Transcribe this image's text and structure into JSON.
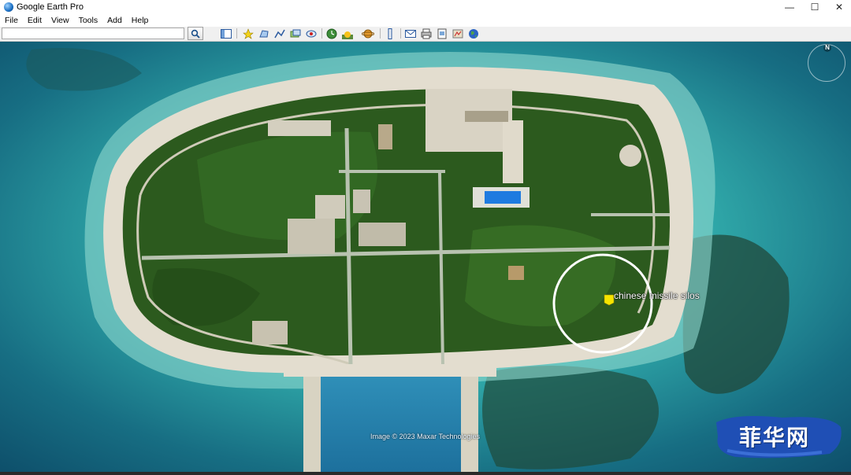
{
  "window": {
    "title": "Google Earth Pro",
    "controls": {
      "minimize": "—",
      "maximize": "☐",
      "close": "✕"
    }
  },
  "menu": {
    "items": [
      "File",
      "Edit",
      "View",
      "Tools",
      "Add",
      "Help"
    ]
  },
  "search": {
    "value": "",
    "placeholder": ""
  },
  "toolbar": {
    "buttons": [
      "sidebar-icon",
      "placemark-icon",
      "polygon-icon",
      "path-icon",
      "image-overlay-icon",
      "record-tour-icon",
      "historical-imagery-icon",
      "sunlight-icon",
      "planets-icon",
      "ruler-icon",
      "email-icon",
      "print-icon",
      "save-image-icon",
      "view-in-maps-icon",
      "earth-icon"
    ]
  },
  "map": {
    "placemark_label": "chinese missile silos",
    "attribution": "Image © 2023 Maxar Technologies",
    "compass_label": "N"
  },
  "watermark": {
    "text": "菲华网"
  },
  "colors": {
    "ocean_deep": "#0f4e6b",
    "lagoon": "#3aa6b8",
    "vegetation": "#2c5a1e",
    "sand": "#e3ddcf",
    "circle": "#ffffff",
    "placemark": "#f5e400",
    "watermark_bg": "#1f4fb5"
  }
}
